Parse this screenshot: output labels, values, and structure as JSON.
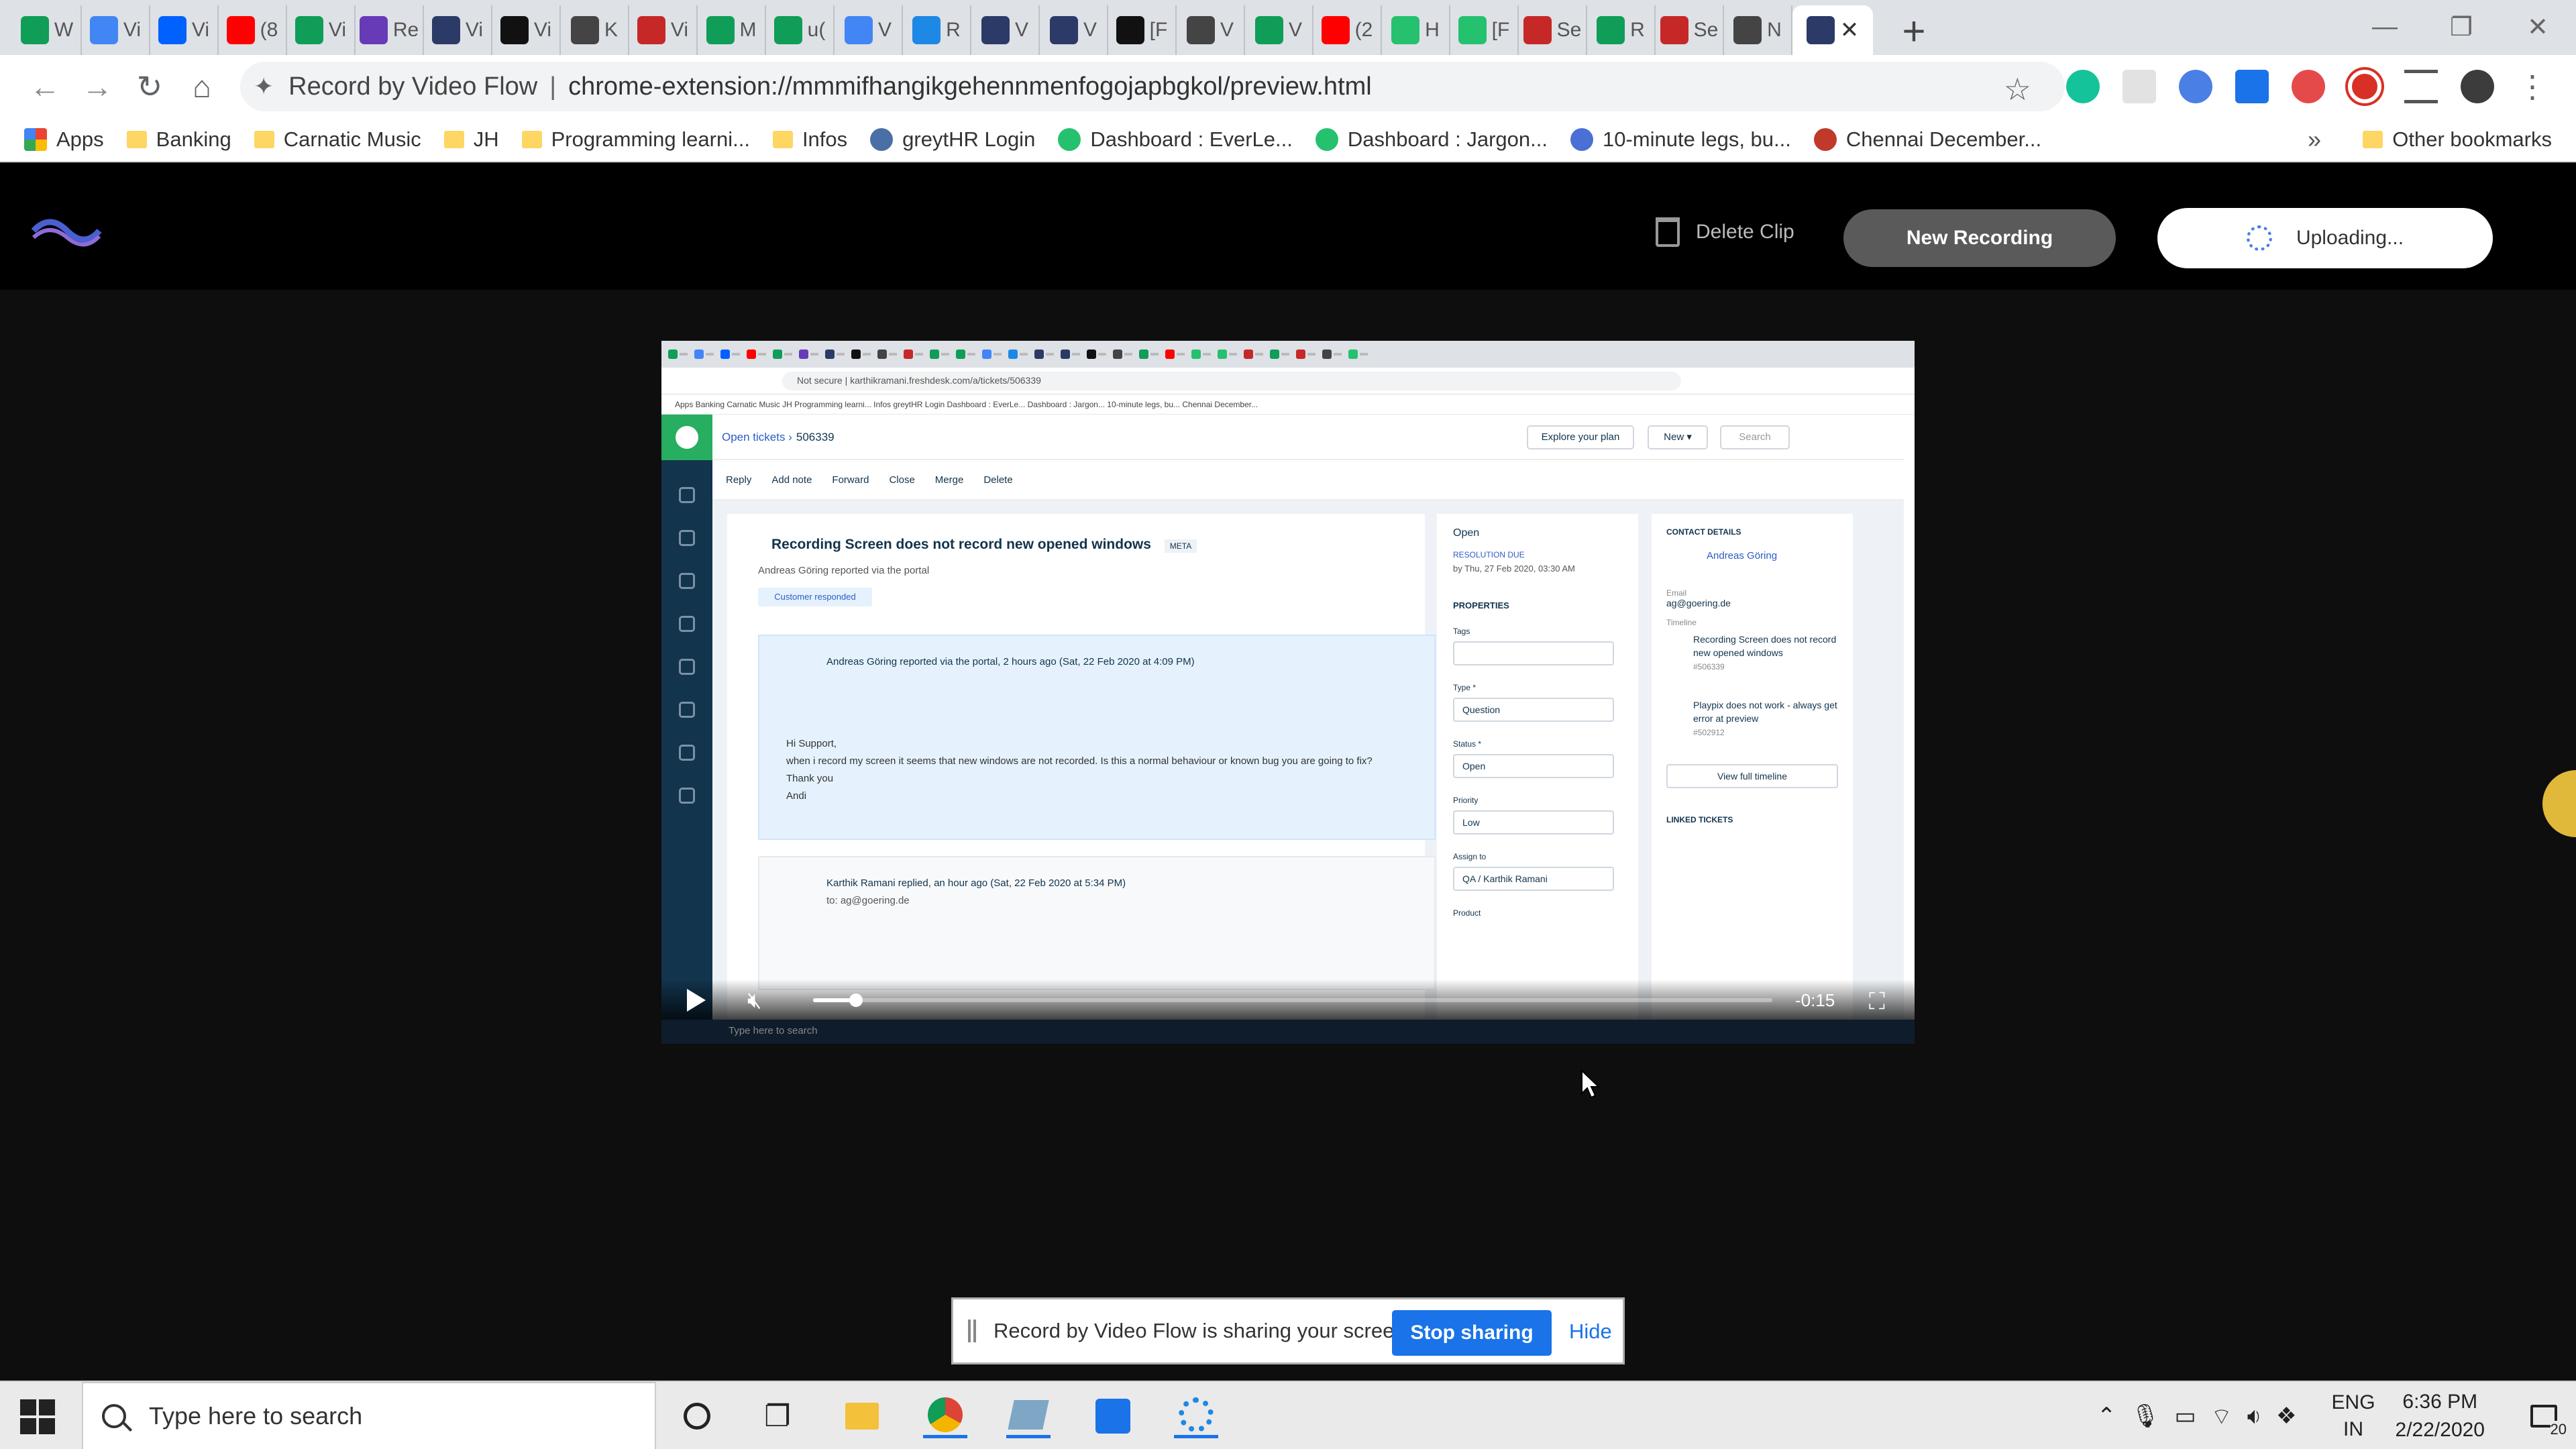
{
  "tabs": [
    {
      "label": "W",
      "icon": "sheets-icon",
      "color": "#0f9d58"
    },
    {
      "label": "Vi",
      "icon": "docs-icon",
      "color": "#4285f4"
    },
    {
      "label": "Vi",
      "icon": "dropbox-icon",
      "color": "#0061fe"
    },
    {
      "label": "(8",
      "icon": "youtube-icon",
      "color": "#ff0000"
    },
    {
      "label": "Vi",
      "icon": "sheets-icon",
      "color": "#0f9d58"
    },
    {
      "label": "Re",
      "icon": "forms-icon",
      "color": "#673ab7"
    },
    {
      "label": "Vi",
      "icon": "videoflow-icon",
      "color": "#2b3a67"
    },
    {
      "label": "Vi",
      "icon": "loom-icon",
      "color": "#111111"
    },
    {
      "label": "K",
      "icon": "github-icon",
      "color": "#444444"
    },
    {
      "label": "Vi",
      "icon": "zoho-icon",
      "color": "#c62828"
    },
    {
      "label": "M",
      "icon": "sheets-icon",
      "color": "#0f9d58"
    },
    {
      "label": "u(",
      "icon": "sheets-icon",
      "color": "#0f9d58"
    },
    {
      "label": "V",
      "icon": "docs-icon",
      "color": "#4285f4"
    },
    {
      "label": "R",
      "icon": "refresh-icon",
      "color": "#1e88e5"
    },
    {
      "label": "V",
      "icon": "videoflow-icon",
      "color": "#2b3a67"
    },
    {
      "label": "V",
      "icon": "videoflow-icon",
      "color": "#2b3a67"
    },
    {
      "label": "[F",
      "icon": "loom-icon",
      "color": "#111111"
    },
    {
      "label": "V",
      "icon": "github-icon",
      "color": "#444444"
    },
    {
      "label": "V",
      "icon": "sheets-icon",
      "color": "#0f9d58"
    },
    {
      "label": "(2",
      "icon": "youtube-icon",
      "color": "#ff0000"
    },
    {
      "label": "H",
      "icon": "freshdesk-icon",
      "color": "#25c16f"
    },
    {
      "label": "[F",
      "icon": "freshdesk-icon",
      "color": "#25c16f"
    },
    {
      "label": "Se",
      "icon": "zoho-icon",
      "color": "#c62828"
    },
    {
      "label": "R",
      "icon": "sheets-icon",
      "color": "#0f9d58"
    },
    {
      "label": "Se",
      "icon": "zoho-icon",
      "color": "#c62828"
    },
    {
      "label": "N",
      "icon": "github-icon",
      "color": "#444444"
    }
  ],
  "active_tab": {
    "icon": "videoflow-icon",
    "close": "✕"
  },
  "window_controls": {
    "minimize": "—",
    "maximize": "❐",
    "close": "✕"
  },
  "address_bar": {
    "origin": "Record by Video Flow",
    "separator": "|",
    "path": "chrome-extension://mmmifhangikgehennmenfogojapbgkol/preview.html"
  },
  "bookmarks": [
    {
      "label": "Apps",
      "type": "apps"
    },
    {
      "label": "Banking",
      "type": "folder"
    },
    {
      "label": "Carnatic Music",
      "type": "folder"
    },
    {
      "label": "JH",
      "type": "folder"
    },
    {
      "label": "Programming learni...",
      "type": "folder"
    },
    {
      "label": "Infos",
      "type": "folder"
    },
    {
      "label": "greytHR Login",
      "type": "site",
      "color": "#4a6fa5"
    },
    {
      "label": "Dashboard : EverLe...",
      "type": "site",
      "color": "#25c16f"
    },
    {
      "label": "Dashboard : Jargon...",
      "type": "site",
      "color": "#25c16f"
    },
    {
      "label": "10-minute legs, bu...",
      "type": "site",
      "color": "#4a6fd5"
    },
    {
      "label": "Chennai December...",
      "type": "site",
      "color": "#c0392b"
    }
  ],
  "bookmarks_overflow": "»",
  "other_bookmarks": "Other bookmarks",
  "app": {
    "delete_clip": "Delete Clip",
    "new_recording": "New Recording",
    "uploading": "Uploading..."
  },
  "video": {
    "tab_colors": [
      "#0f9d58",
      "#4285f4",
      "#0061fe",
      "#ff0000",
      "#0f9d58",
      "#673ab7",
      "#2b3a67",
      "#111111",
      "#444444",
      "#c62828",
      "#0f9d58",
      "#0f9d58",
      "#4285f4",
      "#1e88e5",
      "#2b3a67",
      "#2b3a67",
      "#111111",
      "#444444",
      "#0f9d58",
      "#ff0000",
      "#25c16f",
      "#25c16f",
      "#c62828",
      "#0f9d58",
      "#c62828",
      "#444444",
      "#25c16f"
    ],
    "url": "Not secure  |  karthikramani.freshdesk.com/a/tickets/506339",
    "bookmarks_line": "Apps   Banking   Carnatic Music   JH   Programming learni...   Infos   greytHR Login   Dashboard : EverLe...   Dashboard : Jargon...   10-minute legs, bu...   Chennai December...",
    "breadcrumb": "Open tickets  ›",
    "ticket_id": "506339",
    "explore": "Explore your plan",
    "new": "New ▾",
    "search": "Search",
    "actions": [
      "Reply",
      "Add note",
      "Forward",
      "Close",
      "Merge",
      "Delete"
    ],
    "ticket_title": "Recording Screen does not record new opened windows",
    "ticket_tag": "META",
    "reporter": "Andreas Göring reported via the portal",
    "customer_responded": "Customer responded",
    "message1_header": "Andreas Göring  reported via the portal, 2 hours ago (Sat, 22 Feb 2020 at 4:09 PM)",
    "message1_body": [
      "Hi Support,",
      "when i record my screen it seems that new windows are not recorded. Is this a normal behaviour or known bug you are going to fix?",
      "Thank you",
      "Andi"
    ],
    "message2_header": "Karthik Ramani  replied, an hour ago (Sat, 22 Feb 2020 at 5:34 PM)",
    "message2_to": "to: ag@goering.de",
    "status_open": "Open",
    "resolution_due": "RESOLUTION DUE",
    "resolution_date": "by Thu, 27 Feb 2020, 03:30 AM",
    "properties": "PROPERTIES",
    "tags_label": "Tags",
    "type_label": "Type *",
    "type_value": "Question",
    "status_label": "Status *",
    "status_value": "Open",
    "priority_label": "Priority",
    "priority_value": "Low",
    "assign_label": "Assign to",
    "assign_value": "QA / Karthik Ramani",
    "product_label": "Product",
    "contact_details": "CONTACT DETAILS",
    "contact_name": "Andreas Göring",
    "email_label": "Email",
    "email": "ag@goering.de",
    "timeline": "Timeline",
    "timeline1": "Recording Screen does not record new opened windows",
    "timeline1_id": "#506339",
    "timeline2": "Playpix does not work - always get error at preview",
    "timeline2_id": "#502912",
    "view_timeline": "View full timeline",
    "linked_tickets": "LINKED TICKETS",
    "remaining": "-0:15",
    "played_fraction": 0.045,
    "inner_search": "Type here to search"
  },
  "share_bar": {
    "message": "Record by Video Flow is sharing your screen.",
    "stop": "Stop sharing",
    "hide": "Hide"
  },
  "taskbar": {
    "search_placeholder": "Type here to search",
    "lang1": "ENG",
    "lang2": "IN",
    "time": "6:36 PM",
    "date": "2/22/2020",
    "notifications": "20"
  }
}
